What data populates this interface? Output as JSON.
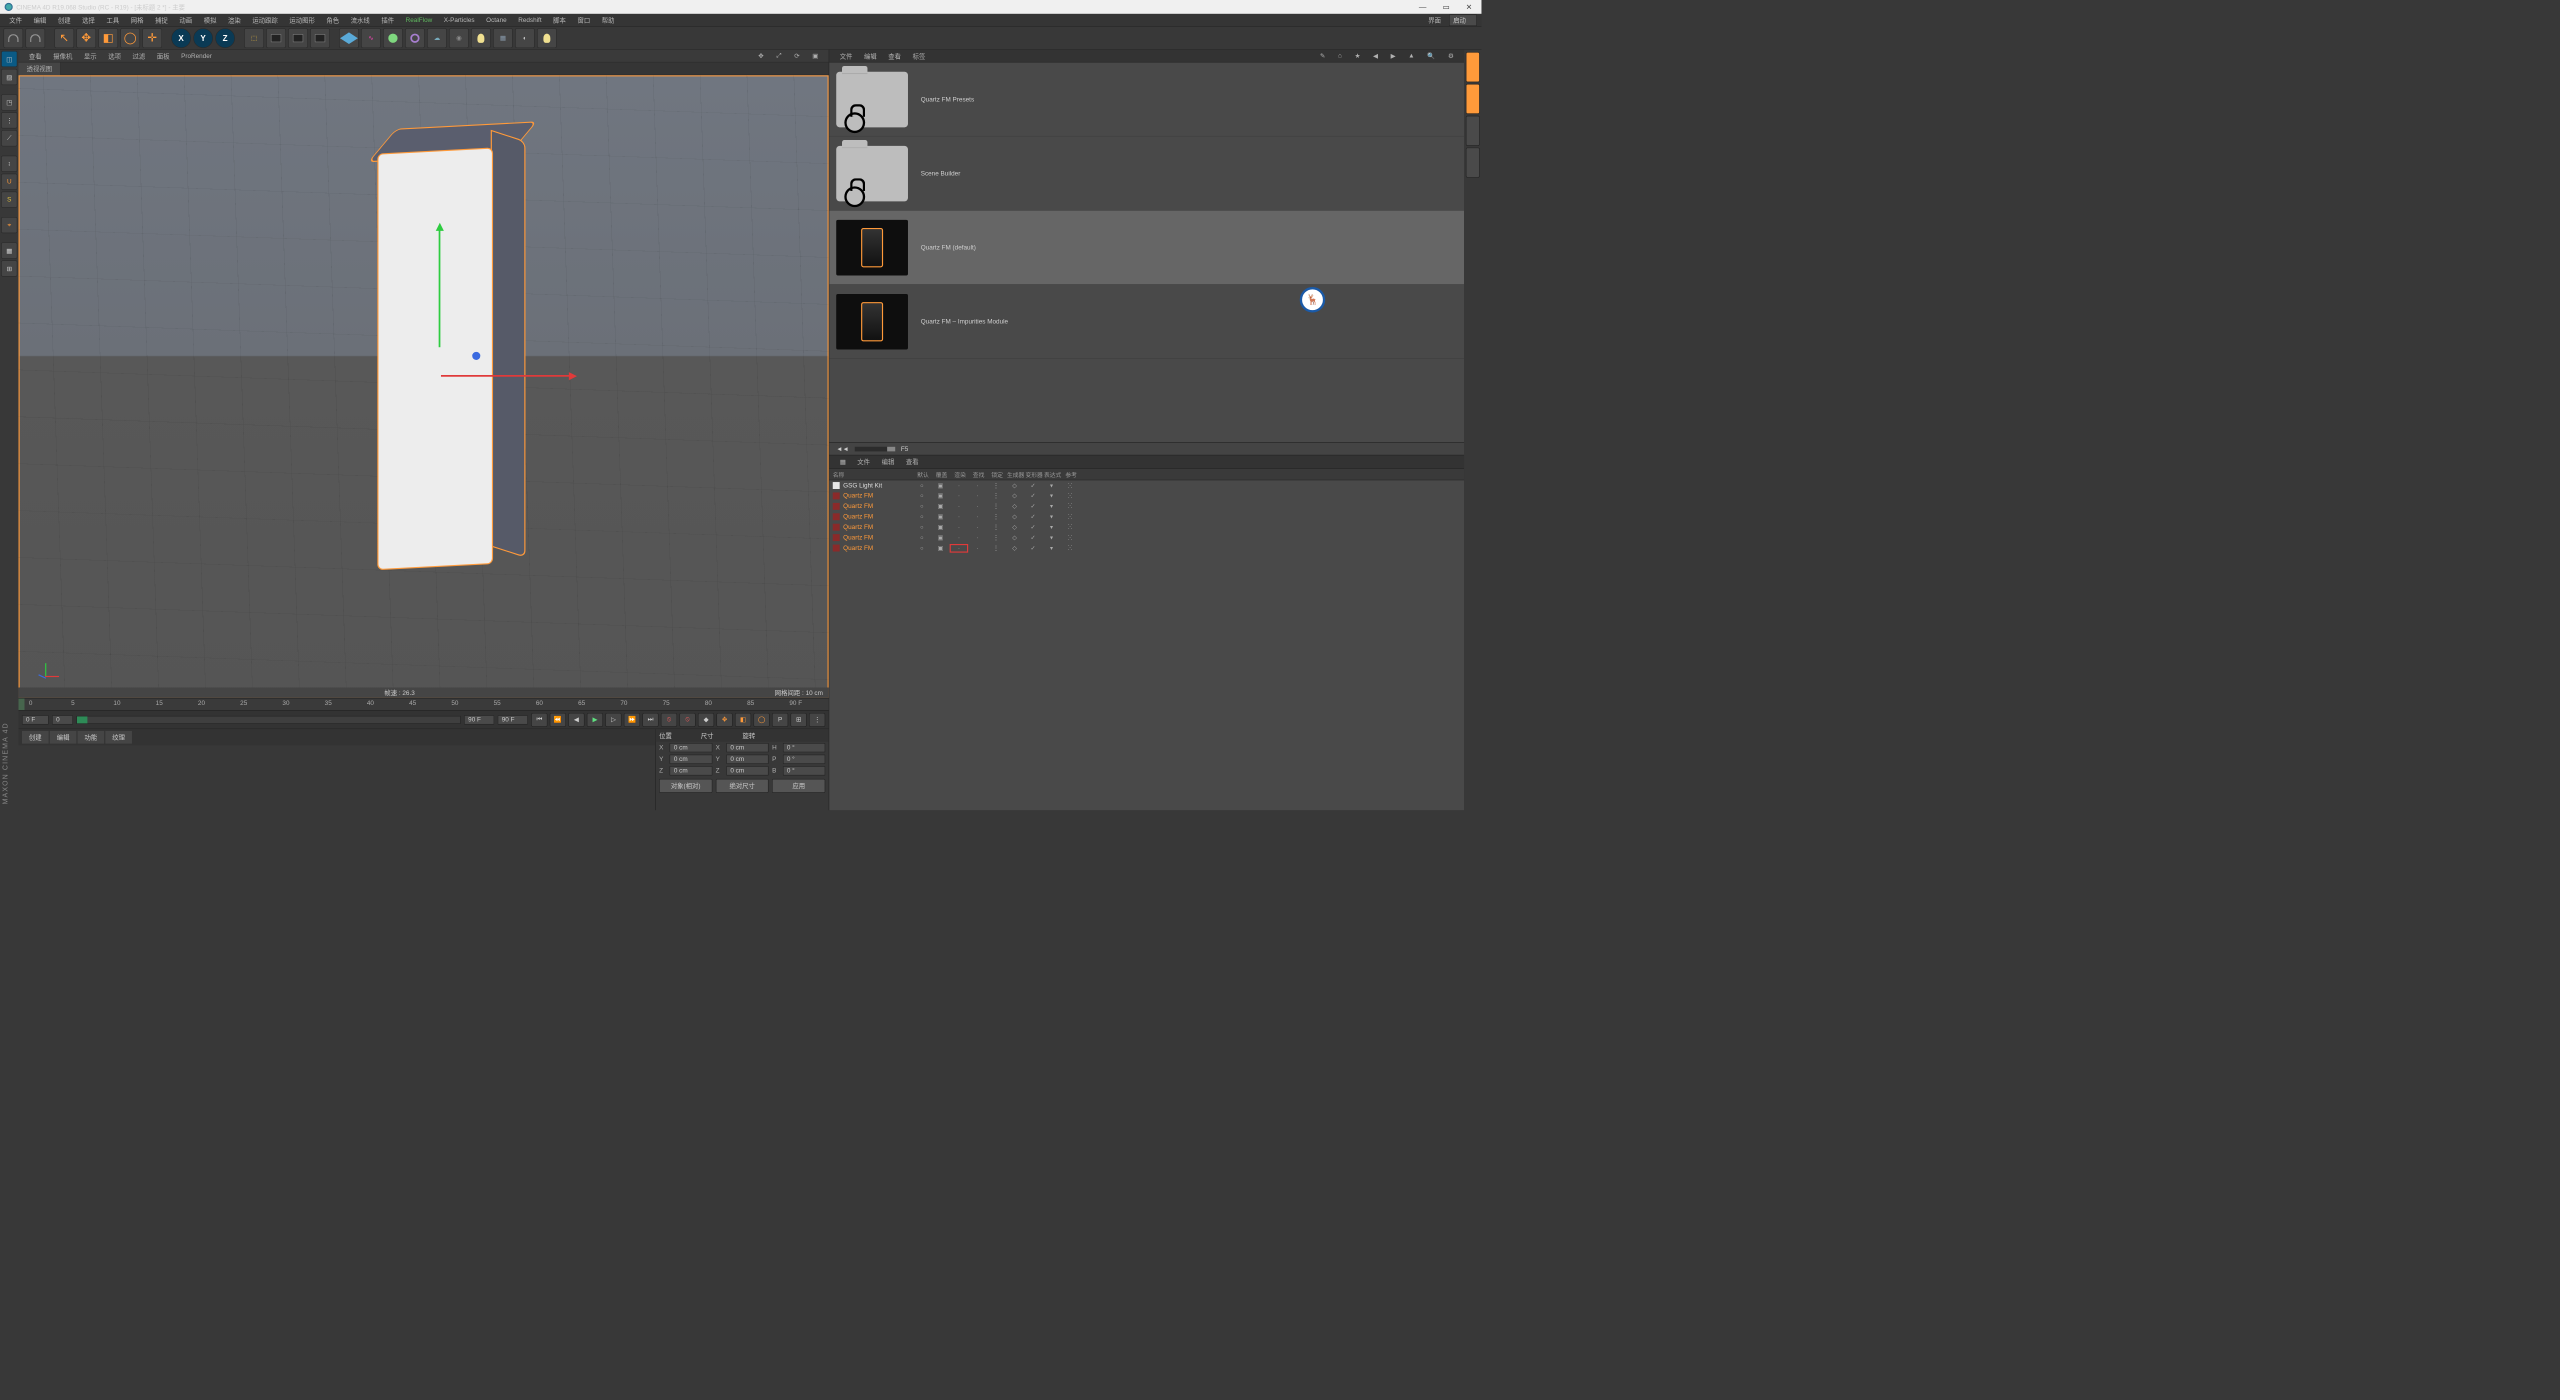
{
  "title": "CINEMA 4D R19.068 Studio (RC - R19) - [未标题 2 *] - 主要",
  "mainmenu": {
    "items": [
      "文件",
      "编辑",
      "创建",
      "选择",
      "工具",
      "网格",
      "捕捉",
      "动画",
      "模拟",
      "渲染",
      "运动跟踪",
      "运动图形",
      "角色",
      "流水线",
      "插件"
    ],
    "plugins": [
      "RealFlow",
      "X-Particles",
      "Octane",
      "Redshift"
    ],
    "end": [
      "脚本",
      "窗口",
      "帮助"
    ],
    "layout_label": "界面",
    "layout_value": "启动"
  },
  "axes": {
    "x": "X",
    "y": "Y",
    "z": "Z"
  },
  "viewmenu": {
    "items": [
      "查看",
      "摄像机",
      "显示",
      "选项",
      "过滤",
      "面板",
      "ProRender"
    ],
    "tab": "透视视图"
  },
  "viewport": {
    "fps_label": "帧速 : 26.3",
    "grid_label": "网格间距 : 10 cm"
  },
  "ruler": {
    "ticks": [
      "0",
      "5",
      "10",
      "15",
      "20",
      "25",
      "30",
      "35",
      "40",
      "45",
      "50",
      "55",
      "60",
      "65",
      "70",
      "75",
      "80",
      "85",
      "90 F"
    ]
  },
  "timeline": {
    "start": "0 F",
    "current": "0",
    "end": "90 F",
    "end2": "90 F"
  },
  "fn_tabs": [
    "创建",
    "编辑",
    "功能",
    "纹理"
  ],
  "xform": {
    "headers": [
      "位置",
      "尺寸",
      "旋转"
    ],
    "rows": [
      {
        "axis": "X",
        "pos": "0 cm",
        "size": "0 cm",
        "rot": "0 °",
        "rot_lbl": "H"
      },
      {
        "axis": "Y",
        "pos": "0 cm",
        "size": "0 cm",
        "rot": "0 °",
        "rot_lbl": "P"
      },
      {
        "axis": "Z",
        "pos": "0 cm",
        "size": "0 cm",
        "rot": "0 °",
        "rot_lbl": "B"
      }
    ],
    "buttons": [
      "对象(相对)",
      "绝对尺寸",
      "应用"
    ]
  },
  "browser": {
    "menu": [
      "文件",
      "编辑",
      "查看",
      "标签"
    ],
    "items": [
      {
        "label": "Quartz FM Presets",
        "type": "folder"
      },
      {
        "label": "Scene Builder",
        "type": "folder"
      },
      {
        "label": "Quartz FM (default)",
        "type": "preset",
        "selected": true
      },
      {
        "label": "Quartz FM – Impurities Module",
        "type": "preset"
      }
    ],
    "pager_label": "F5"
  },
  "takes": {
    "menu": [
      "文件",
      "编辑",
      "查看"
    ],
    "columns": [
      "名称",
      "默认",
      "覆盖",
      "渲染",
      "查找",
      "锁定",
      "生成器",
      "变形器",
      "表达式",
      "参考"
    ],
    "rows": [
      {
        "name": "GSG Light Kit",
        "first": true
      },
      {
        "name": "Quartz FM"
      },
      {
        "name": "Quartz FM"
      },
      {
        "name": "Quartz FM"
      },
      {
        "name": "Quartz FM"
      },
      {
        "name": "Quartz FM"
      },
      {
        "name": "Quartz FM",
        "hl": true
      }
    ]
  },
  "watermark": "MAXON\nCINEMA 4D",
  "stamp": "🦌"
}
